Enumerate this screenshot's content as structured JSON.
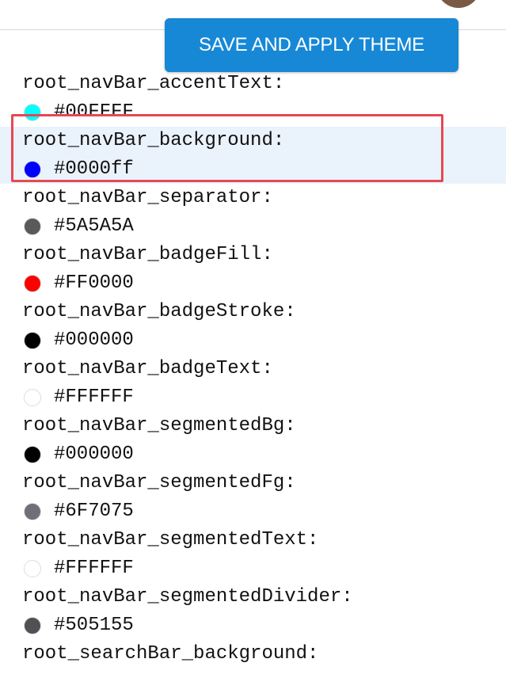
{
  "toolbar": {
    "save_label": "SAVE AND APPLY THEME"
  },
  "colors": {
    "accent": "#1688d6",
    "selection_bg": "#eaf2fc",
    "selection_border": "#e54853"
  },
  "theme_entries": [
    {
      "key": "root_navBar_accentText:",
      "value": "#00FFFF",
      "color": "#00FFFF",
      "selected": false
    },
    {
      "key": "root_navBar_background:",
      "value": "#0000ff",
      "color": "#0000ff",
      "selected": true
    },
    {
      "key": "root_navBar_separator:",
      "value": "#5A5A5A",
      "color": "#5A5A5A",
      "selected": false
    },
    {
      "key": "root_navBar_badgeFill:",
      "value": "#FF0000",
      "color": "#FF0000",
      "selected": false
    },
    {
      "key": "root_navBar_badgeStroke:",
      "value": "#000000",
      "color": "#000000",
      "selected": false
    },
    {
      "key": "root_navBar_badgeText:",
      "value": "#FFFFFF",
      "color": "#FFFFFF",
      "selected": false
    },
    {
      "key": "root_navBar_segmentedBg:",
      "value": "#000000",
      "color": "#000000",
      "selected": false
    },
    {
      "key": "root_navBar_segmentedFg:",
      "value": "#6F7075",
      "color": "#6F7075",
      "selected": false
    },
    {
      "key": "root_navBar_segmentedText:",
      "value": "#FFFFFF",
      "color": "#FFFFFF",
      "selected": false
    },
    {
      "key": "root_navBar_segmentedDivider:",
      "value": "#505155",
      "color": "#505155",
      "selected": false
    },
    {
      "key": "root_searchBar_background:",
      "value": "",
      "color": "",
      "selected": false
    }
  ]
}
